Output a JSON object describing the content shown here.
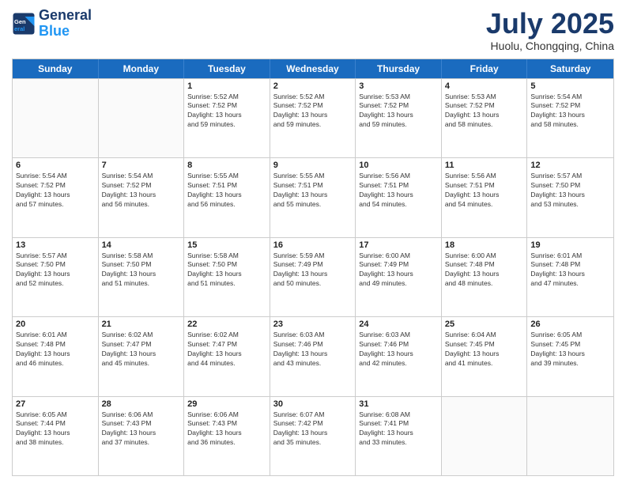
{
  "header": {
    "logo_line1": "General",
    "logo_line2": "Blue",
    "month": "July 2025",
    "location": "Huolu, Chongqing, China"
  },
  "weekdays": [
    "Sunday",
    "Monday",
    "Tuesday",
    "Wednesday",
    "Thursday",
    "Friday",
    "Saturday"
  ],
  "weeks": [
    [
      {
        "day": "",
        "lines": []
      },
      {
        "day": "",
        "lines": []
      },
      {
        "day": "1",
        "lines": [
          "Sunrise: 5:52 AM",
          "Sunset: 7:52 PM",
          "Daylight: 13 hours",
          "and 59 minutes."
        ]
      },
      {
        "day": "2",
        "lines": [
          "Sunrise: 5:52 AM",
          "Sunset: 7:52 PM",
          "Daylight: 13 hours",
          "and 59 minutes."
        ]
      },
      {
        "day": "3",
        "lines": [
          "Sunrise: 5:53 AM",
          "Sunset: 7:52 PM",
          "Daylight: 13 hours",
          "and 59 minutes."
        ]
      },
      {
        "day": "4",
        "lines": [
          "Sunrise: 5:53 AM",
          "Sunset: 7:52 PM",
          "Daylight: 13 hours",
          "and 58 minutes."
        ]
      },
      {
        "day": "5",
        "lines": [
          "Sunrise: 5:54 AM",
          "Sunset: 7:52 PM",
          "Daylight: 13 hours",
          "and 58 minutes."
        ]
      }
    ],
    [
      {
        "day": "6",
        "lines": [
          "Sunrise: 5:54 AM",
          "Sunset: 7:52 PM",
          "Daylight: 13 hours",
          "and 57 minutes."
        ]
      },
      {
        "day": "7",
        "lines": [
          "Sunrise: 5:54 AM",
          "Sunset: 7:52 PM",
          "Daylight: 13 hours",
          "and 56 minutes."
        ]
      },
      {
        "day": "8",
        "lines": [
          "Sunrise: 5:55 AM",
          "Sunset: 7:51 PM",
          "Daylight: 13 hours",
          "and 56 minutes."
        ]
      },
      {
        "day": "9",
        "lines": [
          "Sunrise: 5:55 AM",
          "Sunset: 7:51 PM",
          "Daylight: 13 hours",
          "and 55 minutes."
        ]
      },
      {
        "day": "10",
        "lines": [
          "Sunrise: 5:56 AM",
          "Sunset: 7:51 PM",
          "Daylight: 13 hours",
          "and 54 minutes."
        ]
      },
      {
        "day": "11",
        "lines": [
          "Sunrise: 5:56 AM",
          "Sunset: 7:51 PM",
          "Daylight: 13 hours",
          "and 54 minutes."
        ]
      },
      {
        "day": "12",
        "lines": [
          "Sunrise: 5:57 AM",
          "Sunset: 7:50 PM",
          "Daylight: 13 hours",
          "and 53 minutes."
        ]
      }
    ],
    [
      {
        "day": "13",
        "lines": [
          "Sunrise: 5:57 AM",
          "Sunset: 7:50 PM",
          "Daylight: 13 hours",
          "and 52 minutes."
        ]
      },
      {
        "day": "14",
        "lines": [
          "Sunrise: 5:58 AM",
          "Sunset: 7:50 PM",
          "Daylight: 13 hours",
          "and 51 minutes."
        ]
      },
      {
        "day": "15",
        "lines": [
          "Sunrise: 5:58 AM",
          "Sunset: 7:50 PM",
          "Daylight: 13 hours",
          "and 51 minutes."
        ]
      },
      {
        "day": "16",
        "lines": [
          "Sunrise: 5:59 AM",
          "Sunset: 7:49 PM",
          "Daylight: 13 hours",
          "and 50 minutes."
        ]
      },
      {
        "day": "17",
        "lines": [
          "Sunrise: 6:00 AM",
          "Sunset: 7:49 PM",
          "Daylight: 13 hours",
          "and 49 minutes."
        ]
      },
      {
        "day": "18",
        "lines": [
          "Sunrise: 6:00 AM",
          "Sunset: 7:48 PM",
          "Daylight: 13 hours",
          "and 48 minutes."
        ]
      },
      {
        "day": "19",
        "lines": [
          "Sunrise: 6:01 AM",
          "Sunset: 7:48 PM",
          "Daylight: 13 hours",
          "and 47 minutes."
        ]
      }
    ],
    [
      {
        "day": "20",
        "lines": [
          "Sunrise: 6:01 AM",
          "Sunset: 7:48 PM",
          "Daylight: 13 hours",
          "and 46 minutes."
        ]
      },
      {
        "day": "21",
        "lines": [
          "Sunrise: 6:02 AM",
          "Sunset: 7:47 PM",
          "Daylight: 13 hours",
          "and 45 minutes."
        ]
      },
      {
        "day": "22",
        "lines": [
          "Sunrise: 6:02 AM",
          "Sunset: 7:47 PM",
          "Daylight: 13 hours",
          "and 44 minutes."
        ]
      },
      {
        "day": "23",
        "lines": [
          "Sunrise: 6:03 AM",
          "Sunset: 7:46 PM",
          "Daylight: 13 hours",
          "and 43 minutes."
        ]
      },
      {
        "day": "24",
        "lines": [
          "Sunrise: 6:03 AM",
          "Sunset: 7:46 PM",
          "Daylight: 13 hours",
          "and 42 minutes."
        ]
      },
      {
        "day": "25",
        "lines": [
          "Sunrise: 6:04 AM",
          "Sunset: 7:45 PM",
          "Daylight: 13 hours",
          "and 41 minutes."
        ]
      },
      {
        "day": "26",
        "lines": [
          "Sunrise: 6:05 AM",
          "Sunset: 7:45 PM",
          "Daylight: 13 hours",
          "and 39 minutes."
        ]
      }
    ],
    [
      {
        "day": "27",
        "lines": [
          "Sunrise: 6:05 AM",
          "Sunset: 7:44 PM",
          "Daylight: 13 hours",
          "and 38 minutes."
        ]
      },
      {
        "day": "28",
        "lines": [
          "Sunrise: 6:06 AM",
          "Sunset: 7:43 PM",
          "Daylight: 13 hours",
          "and 37 minutes."
        ]
      },
      {
        "day": "29",
        "lines": [
          "Sunrise: 6:06 AM",
          "Sunset: 7:43 PM",
          "Daylight: 13 hours",
          "and 36 minutes."
        ]
      },
      {
        "day": "30",
        "lines": [
          "Sunrise: 6:07 AM",
          "Sunset: 7:42 PM",
          "Daylight: 13 hours",
          "and 35 minutes."
        ]
      },
      {
        "day": "31",
        "lines": [
          "Sunrise: 6:08 AM",
          "Sunset: 7:41 PM",
          "Daylight: 13 hours",
          "and 33 minutes."
        ]
      },
      {
        "day": "",
        "lines": []
      },
      {
        "day": "",
        "lines": []
      }
    ]
  ]
}
